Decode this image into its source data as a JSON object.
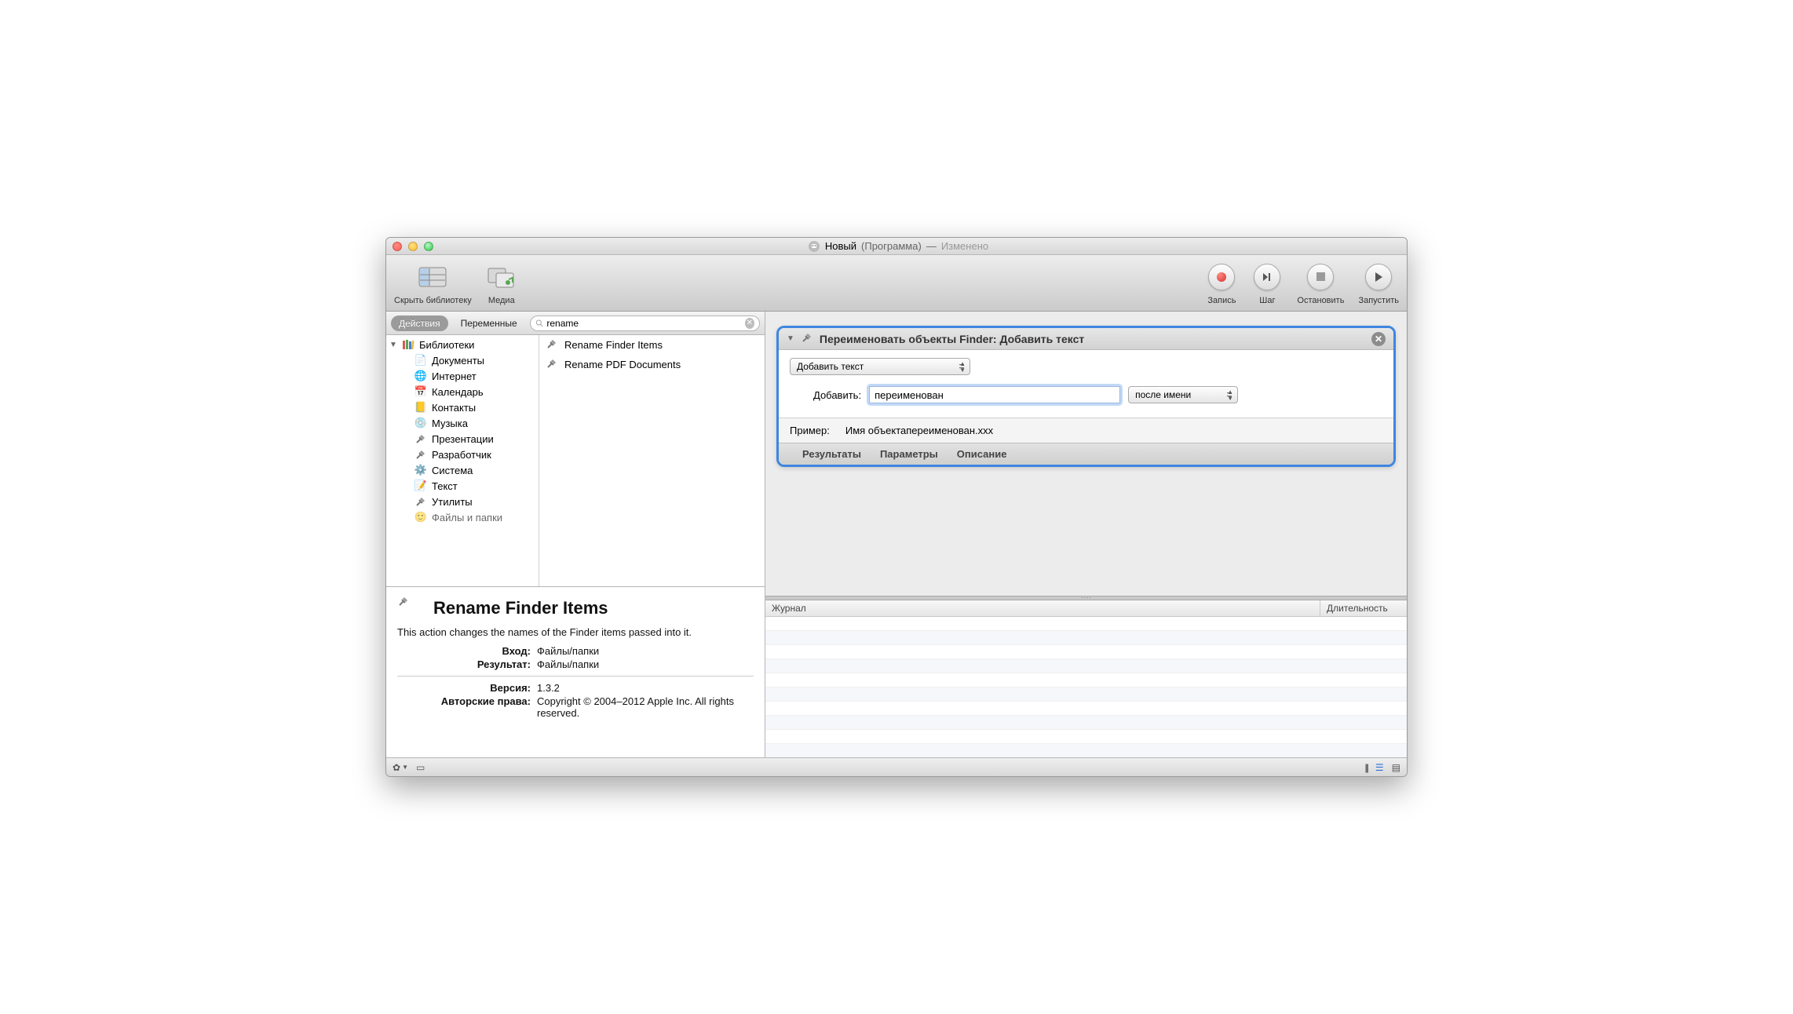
{
  "title": {
    "doc": "Новый",
    "type": "(Программа)",
    "dash": "—",
    "mod": "Изменено"
  },
  "toolbar": {
    "hide_library": "Скрыть библиотеку",
    "media": "Медиа",
    "record": "Запись",
    "step": "Шаг",
    "stop": "Остановить",
    "run": "Запустить"
  },
  "lib": {
    "tab_actions": "Действия",
    "tab_vars": "Переменные",
    "search_value": "rename",
    "root": "Библиотеки",
    "items": [
      "Документы",
      "Интернет",
      "Календарь",
      "Контакты",
      "Музыка",
      "Презентации",
      "Разработчик",
      "Система",
      "Текст",
      "Утилиты",
      "Файлы и папки"
    ]
  },
  "results": [
    "Rename Finder Items",
    "Rename PDF Documents"
  ],
  "desc": {
    "title": "Rename Finder Items",
    "summary": "This action changes the names of the Finder items passed into it.",
    "k_in": "Вход:",
    "v_in": "Файлы/папки",
    "k_out": "Результат:",
    "v_out": "Файлы/папки",
    "k_ver": "Версия:",
    "v_ver": "1.3.2",
    "k_cr": "Авторские права:",
    "v_cr": "Copyright © 2004–2012 Apple Inc.  All rights reserved."
  },
  "action": {
    "title": "Переименовать объекты Finder: Добавить текст",
    "mode": "Добавить текст",
    "add_label": "Добавить:",
    "add_value": "переименован",
    "pos": "после имени",
    "example_label": "Пример:",
    "example_value": "Имя объектапереименован.xxx",
    "tab_results": "Результаты",
    "tab_params": "Параметры",
    "tab_desc": "Описание"
  },
  "log": {
    "col1": "Журнал",
    "col2": "Длительность"
  }
}
